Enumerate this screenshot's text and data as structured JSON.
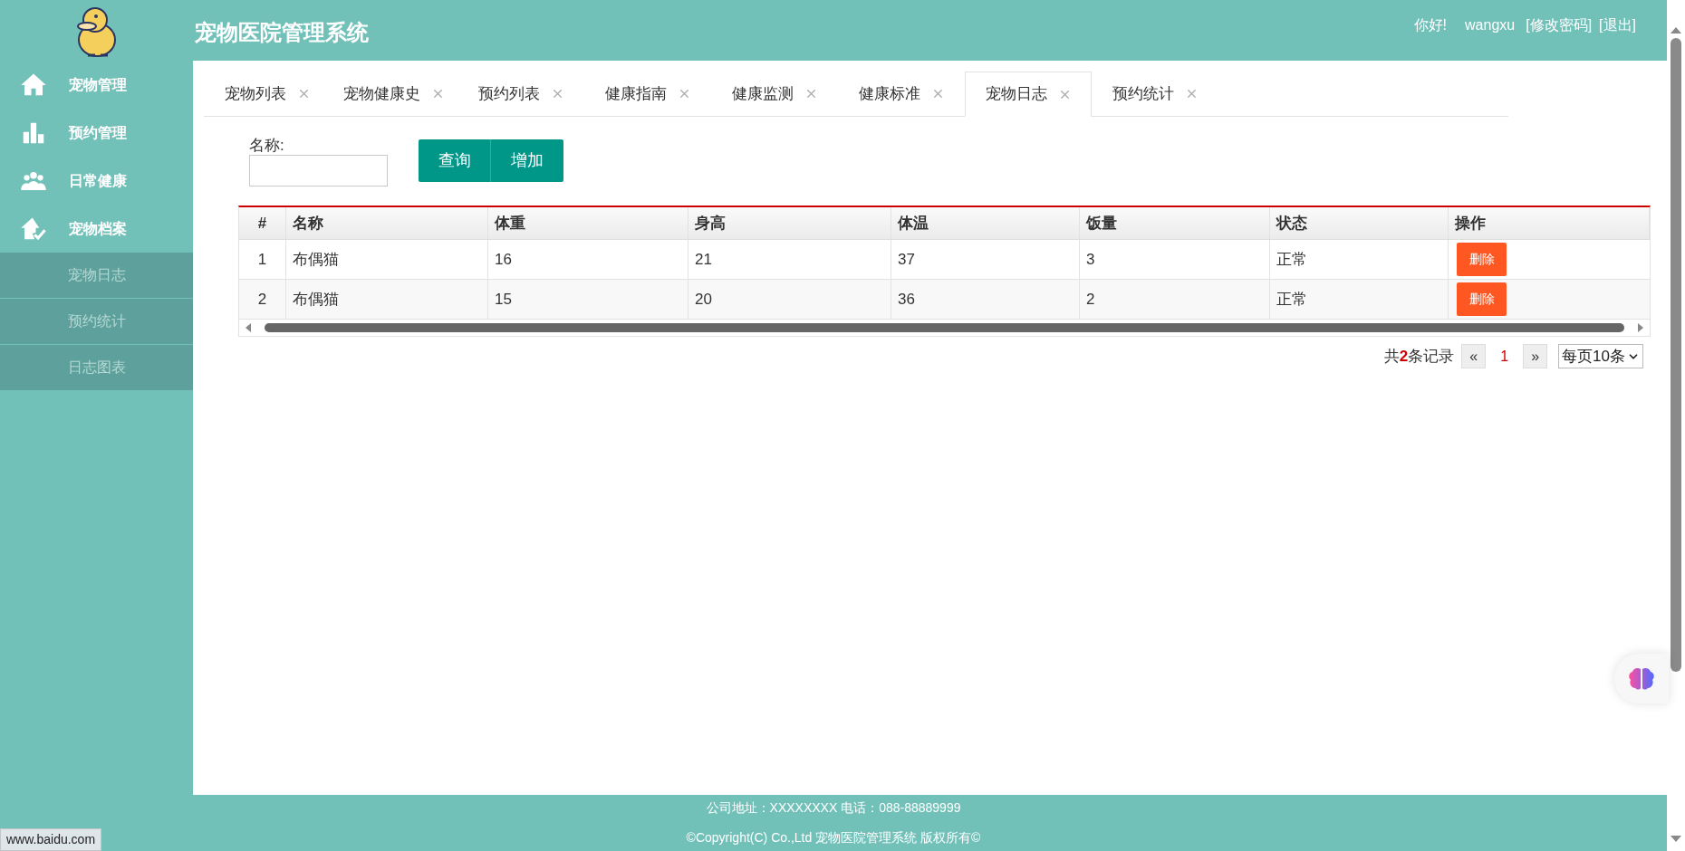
{
  "header": {
    "title": "宠物医院管理系统",
    "greeting": "你好!",
    "user": "wangxu",
    "links": [
      "[修改密码]",
      "[退出]"
    ]
  },
  "sidebar": {
    "items": [
      {
        "kind": "main",
        "label": "宠物管理"
      },
      {
        "kind": "main",
        "label": "预约管理"
      },
      {
        "kind": "main",
        "label": "日常健康"
      },
      {
        "kind": "main",
        "label": "宠物档案"
      },
      {
        "kind": "sub",
        "label": "宠物日志"
      },
      {
        "kind": "sub",
        "label": "预约统计"
      },
      {
        "kind": "sub",
        "label": "日志图表"
      }
    ]
  },
  "tabs": [
    {
      "label": "宠物列表",
      "selected": false
    },
    {
      "label": "宠物健康史",
      "selected": false
    },
    {
      "label": "预约列表",
      "selected": false
    },
    {
      "label": "健康指南",
      "selected": false
    },
    {
      "label": "健康监测",
      "selected": false
    },
    {
      "label": "健康标准",
      "selected": false
    },
    {
      "label": "宠物日志",
      "selected": true
    },
    {
      "label": "预约统计",
      "selected": false
    }
  ],
  "search": {
    "label": "名称:",
    "buttons": [
      "查询",
      "增加"
    ]
  },
  "table": {
    "columns": [
      "#",
      "名称",
      "体重",
      "身高",
      "体温",
      "饭量",
      "状态",
      "操作"
    ],
    "rows": [
      {
        "cells": [
          "1",
          "布偶猫",
          "16",
          "21",
          "37",
          "3",
          "正常"
        ],
        "action": "删除"
      },
      {
        "cells": [
          "2",
          "布偶猫",
          "15",
          "20",
          "36",
          "2",
          "正常"
        ],
        "action": "删除"
      }
    ]
  },
  "pagination": {
    "total_before": "共",
    "total_count": "2",
    "total_after": "条记录",
    "prev": "«",
    "current": "1",
    "next": "»",
    "page_size": "每页10条"
  },
  "footer": [
    "公司地址：XXXXXXXX 电话：088-88889999",
    "©Copyright(C) Co.,Ltd 宠物医院管理系统 版权所有©"
  ],
  "status_bar": "www.baidu.com"
}
